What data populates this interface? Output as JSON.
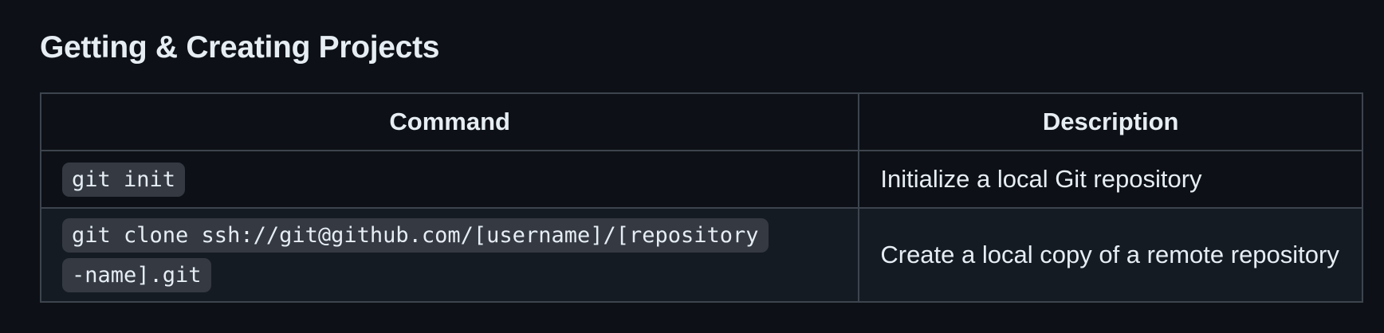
{
  "heading": "Getting & Creating Projects",
  "table": {
    "headers": {
      "command": "Command",
      "description": "Description"
    },
    "rows": [
      {
        "command": "git init",
        "description": "Initialize a local Git repository"
      },
      {
        "command": "git clone ssh://git@github.com/[username]/[repository-name].git",
        "description": "Create a local copy of a remote repository"
      }
    ]
  },
  "colors": {
    "background": "#0d1117",
    "row_alt_background": "#151b23",
    "border": "#3d444d",
    "code_background": "#343942",
    "text": "#e6edf3"
  }
}
